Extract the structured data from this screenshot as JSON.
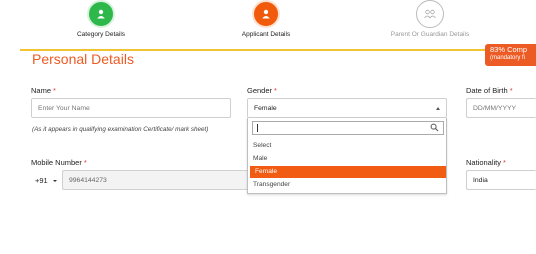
{
  "stepper": {
    "steps": [
      {
        "label": "Category Details",
        "status": "complete",
        "color": "#2eb84b",
        "icon": "user-icon"
      },
      {
        "label": "Applicant Details",
        "status": "active",
        "color": "#f05a0a",
        "icon": "user-icon"
      },
      {
        "label": "Parent Or Guardian Details",
        "status": "pending",
        "color": "#bbbbbb",
        "icon": "family-icon"
      }
    ]
  },
  "progress_badge": {
    "line1": "83% Comp",
    "line2": "(mandatory fi",
    "color": "#ec5b24"
  },
  "section": {
    "title": "Personal Details"
  },
  "form": {
    "name": {
      "label": "Name",
      "required": "*",
      "placeholder": "Enter Your Name",
      "hint": "(As it appears in qualifying examination Certificate/ mark sheet)"
    },
    "gender": {
      "label": "Gender",
      "required": "*",
      "value": "Female",
      "options": [
        "Select",
        "Male",
        "Female",
        "Transgender"
      ],
      "highlighted": "Female"
    },
    "dob": {
      "label": "Date of Birth",
      "required": "*",
      "placeholder": "DD/MM/YYYY"
    },
    "mobile": {
      "label": "Mobile Number",
      "required": "*",
      "country_code": "+91",
      "value": "9964144273"
    },
    "nationality": {
      "label": "Nationality",
      "required": "*",
      "value": "India"
    }
  },
  "colors": {
    "accent": "#ec5b24",
    "highlight": "#f25c12",
    "rule": "#f3c432"
  }
}
